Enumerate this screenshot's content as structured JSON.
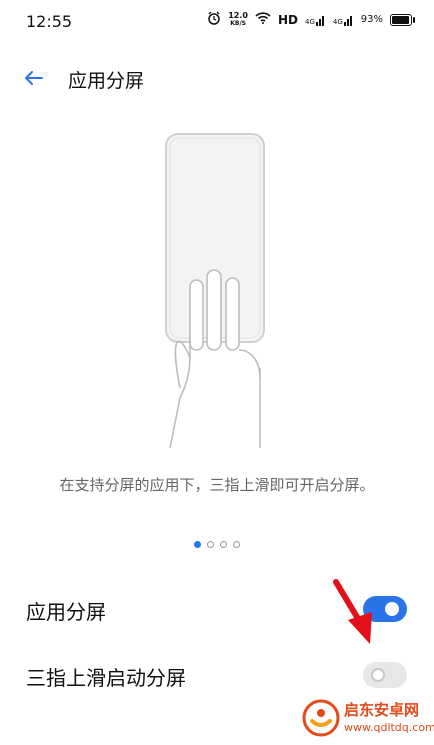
{
  "status_bar": {
    "time": "12:55",
    "net_speed_value": "12.0",
    "net_speed_unit": "KB/S",
    "hd_label": "HD",
    "sig1_label": "4G",
    "sig2_label": "4G",
    "battery_percent": "93%",
    "battery_level": 0.93
  },
  "header": {
    "title": "应用分屏"
  },
  "illustration": {
    "hint": "在支持分屏的应用下，三指上滑即可开启分屏。",
    "page_count": 4,
    "active_page": 0
  },
  "settings": [
    {
      "label": "应用分屏",
      "enabled": true
    },
    {
      "label": "三指上滑启动分屏",
      "enabled": false
    }
  ],
  "colors": {
    "accent": "#2a73e8",
    "annotation_arrow": "#e3101a",
    "watermark": "#e24a1a"
  },
  "watermark": {
    "name": "启东安卓网",
    "url": "www.qdltdq.com"
  }
}
